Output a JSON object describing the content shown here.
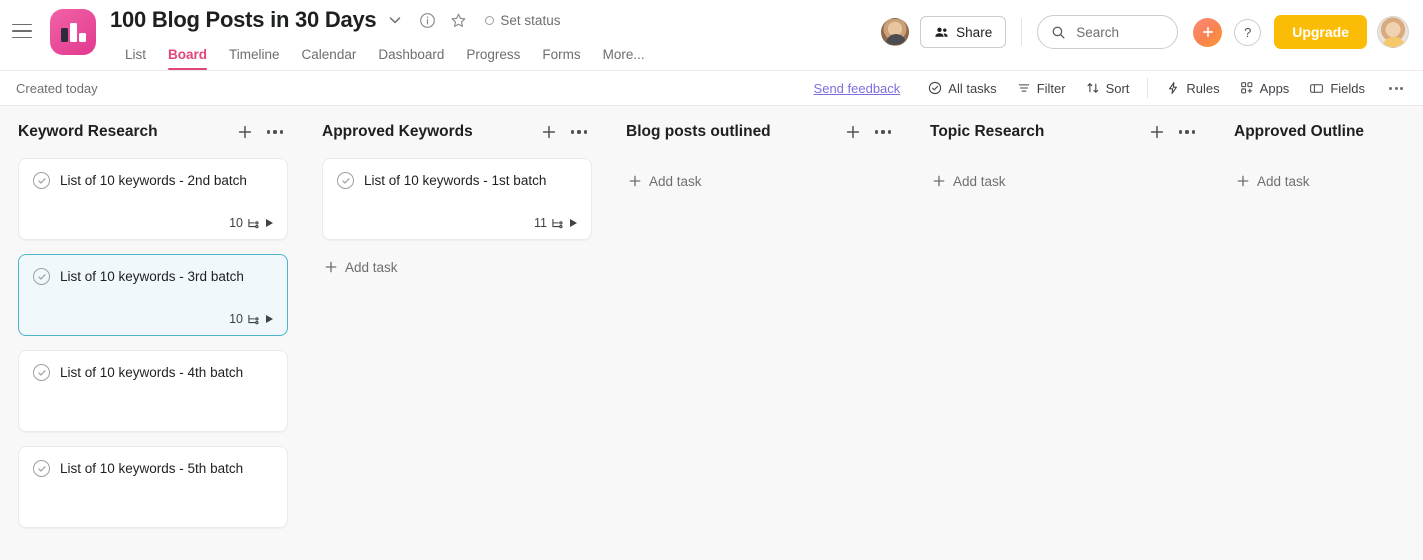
{
  "header": {
    "menu_icon": "hamburger-icon",
    "project_icon": "board-project-icon",
    "project_title": "100 Blog Posts in 30 Days",
    "chevron_icon": "chevron-down-icon",
    "info_icon": "info-icon",
    "star_icon": "star-icon",
    "set_status": "Set status",
    "tabs": [
      {
        "label": "List",
        "active": false
      },
      {
        "label": "Board",
        "active": true
      },
      {
        "label": "Timeline",
        "active": false
      },
      {
        "label": "Calendar",
        "active": false
      },
      {
        "label": "Dashboard",
        "active": false
      },
      {
        "label": "Progress",
        "active": false
      },
      {
        "label": "Forms",
        "active": false
      },
      {
        "label": "More...",
        "active": false
      }
    ],
    "share_label": "Share",
    "share_icon": "people-icon",
    "search_placeholder": "Search",
    "search_value": "",
    "search_icon": "search-icon",
    "plus_icon": "plus-icon",
    "help_label": "?",
    "upgrade_label": "Upgrade",
    "avatar_left": "avatar",
    "avatar_right": "avatar",
    "accent_pink": "#e0457b",
    "logo_pink": "#e1398f",
    "upgrade_yellow": "#fbbc05"
  },
  "subheader": {
    "created": "Created today",
    "feedback": "Send feedback",
    "items": [
      {
        "label": "All tasks",
        "icon": "check-circle-icon"
      },
      {
        "label": "Filter",
        "icon": "filter-icon"
      },
      {
        "label": "Sort",
        "icon": "sort-arrows-icon"
      },
      {
        "label": "Rules",
        "icon": "lightning-icon"
      },
      {
        "label": "Apps",
        "icon": "apps-grid-icon"
      },
      {
        "label": "Fields",
        "icon": "fields-icon"
      }
    ],
    "overflow_icon": "more-horizontal-icon"
  },
  "board": {
    "add_task_label": "Add task",
    "add_icon": "plus-icon",
    "column_menu_icon": "more-horizontal-icon",
    "selection_color": "#4eb3cf",
    "columns": [
      {
        "title": "Keyword Research",
        "show_add_task": false,
        "cards": [
          {
            "title": "List of 10 keywords - 2nd batch",
            "subtask_count": "10",
            "has_subtasks": true,
            "selected": false
          },
          {
            "title": "List of 10 keywords - 3rd batch",
            "subtask_count": "10",
            "has_subtasks": true,
            "selected": true
          },
          {
            "title": "List of 10 keywords - 4th batch",
            "subtask_count": "",
            "has_subtasks": false,
            "selected": false
          },
          {
            "title": "List of 10 keywords - 5th batch",
            "subtask_count": "",
            "has_subtasks": false,
            "selected": false
          }
        ]
      },
      {
        "title": "Approved Keywords",
        "show_add_task": true,
        "cards": [
          {
            "title": "List of 10 keywords - 1st batch",
            "subtask_count": "11",
            "has_subtasks": true,
            "selected": false
          }
        ]
      },
      {
        "title": "Blog posts outlined",
        "show_add_task": true,
        "cards": []
      },
      {
        "title": "Topic Research",
        "show_add_task": true,
        "cards": []
      },
      {
        "title": "Approved Outline",
        "show_add_task": true,
        "cards": []
      }
    ]
  }
}
